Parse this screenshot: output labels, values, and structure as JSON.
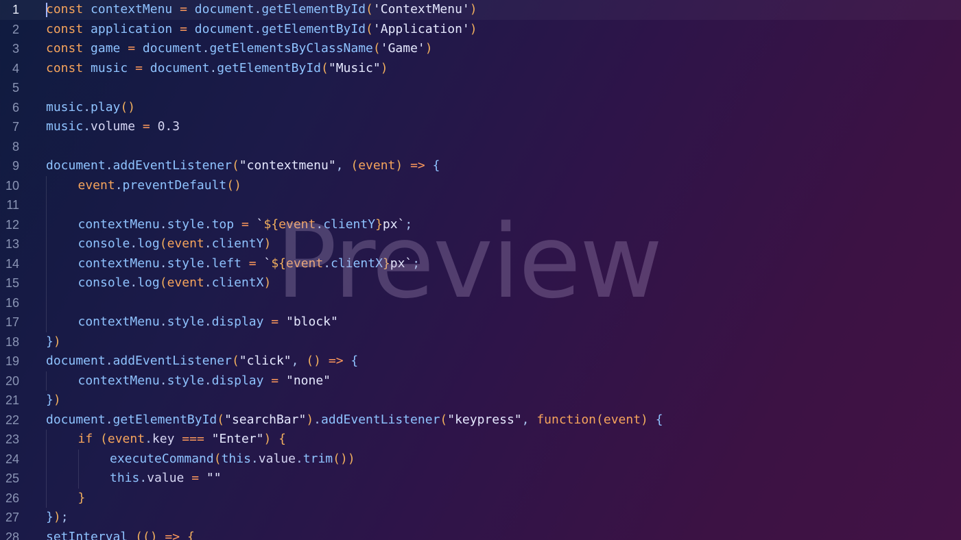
{
  "editor": {
    "current_line": 1,
    "lines": [
      {
        "num": "1",
        "indent": 0,
        "tokens": [
          [
            "k",
            "const"
          ],
          [
            "m",
            " "
          ],
          [
            "v",
            "contextMenu"
          ],
          [
            "m",
            " "
          ],
          [
            "o",
            "="
          ],
          [
            "m",
            " "
          ],
          [
            "v",
            "document"
          ],
          [
            "m",
            "."
          ],
          [
            "f",
            "getElementById"
          ],
          [
            "p",
            "("
          ],
          [
            "s",
            "'ContextMenu'"
          ],
          [
            "p",
            ")"
          ]
        ]
      },
      {
        "num": "2",
        "indent": 0,
        "tokens": [
          [
            "k",
            "const"
          ],
          [
            "m",
            " "
          ],
          [
            "v",
            "application"
          ],
          [
            "m",
            " "
          ],
          [
            "o",
            "="
          ],
          [
            "m",
            " "
          ],
          [
            "v",
            "document"
          ],
          [
            "m",
            "."
          ],
          [
            "f",
            "getElementById"
          ],
          [
            "p",
            "("
          ],
          [
            "s",
            "'Application'"
          ],
          [
            "p",
            ")"
          ]
        ]
      },
      {
        "num": "3",
        "indent": 0,
        "tokens": [
          [
            "k",
            "const"
          ],
          [
            "m",
            " "
          ],
          [
            "v",
            "game"
          ],
          [
            "m",
            " "
          ],
          [
            "o",
            "="
          ],
          [
            "m",
            " "
          ],
          [
            "v",
            "document"
          ],
          [
            "m",
            "."
          ],
          [
            "f",
            "getElementsByClassName"
          ],
          [
            "p",
            "("
          ],
          [
            "s",
            "'Game'"
          ],
          [
            "p",
            ")"
          ]
        ]
      },
      {
        "num": "4",
        "indent": 0,
        "tokens": [
          [
            "k",
            "const"
          ],
          [
            "m",
            " "
          ],
          [
            "v",
            "music"
          ],
          [
            "m",
            " "
          ],
          [
            "o",
            "="
          ],
          [
            "m",
            " "
          ],
          [
            "v",
            "document"
          ],
          [
            "m",
            "."
          ],
          [
            "f",
            "getElementById"
          ],
          [
            "p",
            "("
          ],
          [
            "s",
            "\"Music\""
          ],
          [
            "p",
            ")"
          ]
        ]
      },
      {
        "num": "5",
        "indent": 0,
        "tokens": []
      },
      {
        "num": "6",
        "indent": 0,
        "tokens": [
          [
            "v",
            "music"
          ],
          [
            "m",
            "."
          ],
          [
            "f",
            "play"
          ],
          [
            "p",
            "()"
          ]
        ]
      },
      {
        "num": "7",
        "indent": 0,
        "tokens": [
          [
            "v",
            "music"
          ],
          [
            "m",
            "."
          ],
          [
            "n",
            "volume"
          ],
          [
            "m",
            " "
          ],
          [
            "o",
            "="
          ],
          [
            "m",
            " "
          ],
          [
            "n",
            "0.3"
          ]
        ]
      },
      {
        "num": "8",
        "indent": 0,
        "tokens": []
      },
      {
        "num": "9",
        "indent": 0,
        "tokens": [
          [
            "v",
            "document"
          ],
          [
            "m",
            "."
          ],
          [
            "f",
            "addEventListener"
          ],
          [
            "p",
            "("
          ],
          [
            "s",
            "\"contextmenu\""
          ],
          [
            "m",
            ", "
          ],
          [
            "p",
            "("
          ],
          [
            "k",
            "event"
          ],
          [
            "p",
            ")"
          ],
          [
            "m",
            " "
          ],
          [
            "o",
            "=>"
          ],
          [
            "m",
            " "
          ],
          [
            "v",
            "{"
          ]
        ]
      },
      {
        "num": "10",
        "indent": 1,
        "tokens": [
          [
            "k",
            "event"
          ],
          [
            "m",
            "."
          ],
          [
            "f",
            "preventDefault"
          ],
          [
            "p",
            "()"
          ]
        ]
      },
      {
        "num": "11",
        "indent": 1,
        "tokens": []
      },
      {
        "num": "12",
        "indent": 1,
        "tokens": [
          [
            "v",
            "contextMenu"
          ],
          [
            "m",
            "."
          ],
          [
            "v",
            "style"
          ],
          [
            "m",
            "."
          ],
          [
            "f",
            "top"
          ],
          [
            "m",
            " "
          ],
          [
            "o",
            "="
          ],
          [
            "m",
            " "
          ],
          [
            "s",
            "`"
          ],
          [
            "p",
            "${"
          ],
          [
            "k",
            "event"
          ],
          [
            "m",
            "."
          ],
          [
            "f",
            "clientY"
          ],
          [
            "p",
            "}"
          ],
          [
            "s",
            "px`"
          ],
          [
            "m",
            ";"
          ]
        ]
      },
      {
        "num": "13",
        "indent": 1,
        "tokens": [
          [
            "v",
            "console"
          ],
          [
            "m",
            "."
          ],
          [
            "f",
            "log"
          ],
          [
            "p",
            "("
          ],
          [
            "k",
            "event"
          ],
          [
            "m",
            "."
          ],
          [
            "f",
            "clientY"
          ],
          [
            "p",
            ")"
          ]
        ]
      },
      {
        "num": "14",
        "indent": 1,
        "tokens": [
          [
            "v",
            "contextMenu"
          ],
          [
            "m",
            "."
          ],
          [
            "v",
            "style"
          ],
          [
            "m",
            "."
          ],
          [
            "f",
            "left"
          ],
          [
            "m",
            " "
          ],
          [
            "o",
            "="
          ],
          [
            "m",
            " "
          ],
          [
            "s",
            "`"
          ],
          [
            "p",
            "${"
          ],
          [
            "k",
            "event"
          ],
          [
            "m",
            "."
          ],
          [
            "f",
            "clientX"
          ],
          [
            "p",
            "}"
          ],
          [
            "s",
            "px`"
          ],
          [
            "m",
            ";"
          ]
        ]
      },
      {
        "num": "15",
        "indent": 1,
        "tokens": [
          [
            "v",
            "console"
          ],
          [
            "m",
            "."
          ],
          [
            "f",
            "log"
          ],
          [
            "p",
            "("
          ],
          [
            "k",
            "event"
          ],
          [
            "m",
            "."
          ],
          [
            "f",
            "clientX"
          ],
          [
            "p",
            ")"
          ]
        ]
      },
      {
        "num": "16",
        "indent": 1,
        "tokens": []
      },
      {
        "num": "17",
        "indent": 1,
        "tokens": [
          [
            "v",
            "contextMenu"
          ],
          [
            "m",
            "."
          ],
          [
            "v",
            "style"
          ],
          [
            "m",
            "."
          ],
          [
            "f",
            "display"
          ],
          [
            "m",
            " "
          ],
          [
            "o",
            "="
          ],
          [
            "m",
            " "
          ],
          [
            "s",
            "\"block\""
          ]
        ]
      },
      {
        "num": "18",
        "indent": 0,
        "tokens": [
          [
            "v",
            "}"
          ],
          [
            "p",
            ")"
          ]
        ]
      },
      {
        "num": "19",
        "indent": 0,
        "tokens": [
          [
            "v",
            "document"
          ],
          [
            "m",
            "."
          ],
          [
            "f",
            "addEventListener"
          ],
          [
            "p",
            "("
          ],
          [
            "s",
            "\"click\""
          ],
          [
            "m",
            ", "
          ],
          [
            "p",
            "()"
          ],
          [
            "m",
            " "
          ],
          [
            "o",
            "=>"
          ],
          [
            "m",
            " "
          ],
          [
            "v",
            "{"
          ]
        ]
      },
      {
        "num": "20",
        "indent": 1,
        "tokens": [
          [
            "v",
            "contextMenu"
          ],
          [
            "m",
            "."
          ],
          [
            "v",
            "style"
          ],
          [
            "m",
            "."
          ],
          [
            "f",
            "display"
          ],
          [
            "m",
            " "
          ],
          [
            "o",
            "="
          ],
          [
            "m",
            " "
          ],
          [
            "s",
            "\"none\""
          ]
        ]
      },
      {
        "num": "21",
        "indent": 0,
        "tokens": [
          [
            "v",
            "}"
          ],
          [
            "p",
            ")"
          ]
        ]
      },
      {
        "num": "22",
        "indent": 0,
        "tokens": [
          [
            "v",
            "document"
          ],
          [
            "m",
            "."
          ],
          [
            "f",
            "getElementById"
          ],
          [
            "p",
            "("
          ],
          [
            "s",
            "\"searchBar\""
          ],
          [
            "p",
            ")"
          ],
          [
            "m",
            "."
          ],
          [
            "f",
            "addEventListener"
          ],
          [
            "p",
            "("
          ],
          [
            "s",
            "\"keypress\""
          ],
          [
            "m",
            ", "
          ],
          [
            "k",
            "function"
          ],
          [
            "p",
            "("
          ],
          [
            "k",
            "event"
          ],
          [
            "p",
            ")"
          ],
          [
            "m",
            " "
          ],
          [
            "v",
            "{"
          ]
        ]
      },
      {
        "num": "23",
        "indent": 1,
        "tokens": [
          [
            "k",
            "if"
          ],
          [
            "m",
            " "
          ],
          [
            "p",
            "("
          ],
          [
            "k",
            "event"
          ],
          [
            "m",
            "."
          ],
          [
            "n",
            "key"
          ],
          [
            "m",
            " "
          ],
          [
            "o",
            "==="
          ],
          [
            "m",
            " "
          ],
          [
            "s",
            "\"Enter\""
          ],
          [
            "p",
            ")"
          ],
          [
            "m",
            " "
          ],
          [
            "p",
            "{"
          ]
        ]
      },
      {
        "num": "24",
        "indent": 2,
        "tokens": [
          [
            "f",
            "executeCommand"
          ],
          [
            "p",
            "("
          ],
          [
            "v",
            "this"
          ],
          [
            "m",
            "."
          ],
          [
            "n",
            "value"
          ],
          [
            "m",
            "."
          ],
          [
            "f",
            "trim"
          ],
          [
            "p",
            "())"
          ]
        ]
      },
      {
        "num": "25",
        "indent": 2,
        "tokens": [
          [
            "v",
            "this"
          ],
          [
            "m",
            "."
          ],
          [
            "n",
            "value"
          ],
          [
            "m",
            " "
          ],
          [
            "o",
            "="
          ],
          [
            "m",
            " "
          ],
          [
            "s",
            "\"\""
          ]
        ]
      },
      {
        "num": "26",
        "indent": 1,
        "tokens": [
          [
            "p",
            "}"
          ]
        ]
      },
      {
        "num": "27",
        "indent": 0,
        "tokens": [
          [
            "v",
            "}"
          ],
          [
            "p",
            ")"
          ],
          [
            "m",
            ";"
          ]
        ]
      },
      {
        "num": "28",
        "indent": 0,
        "tokens": [
          [
            "f",
            "setInterval"
          ],
          [
            "m",
            " "
          ],
          [
            "p",
            "(()"
          ],
          [
            "m",
            " "
          ],
          [
            "o",
            "=>"
          ],
          [
            "m",
            " "
          ],
          [
            "p",
            "{"
          ]
        ]
      }
    ]
  },
  "watermark": {
    "text": "Preview"
  }
}
